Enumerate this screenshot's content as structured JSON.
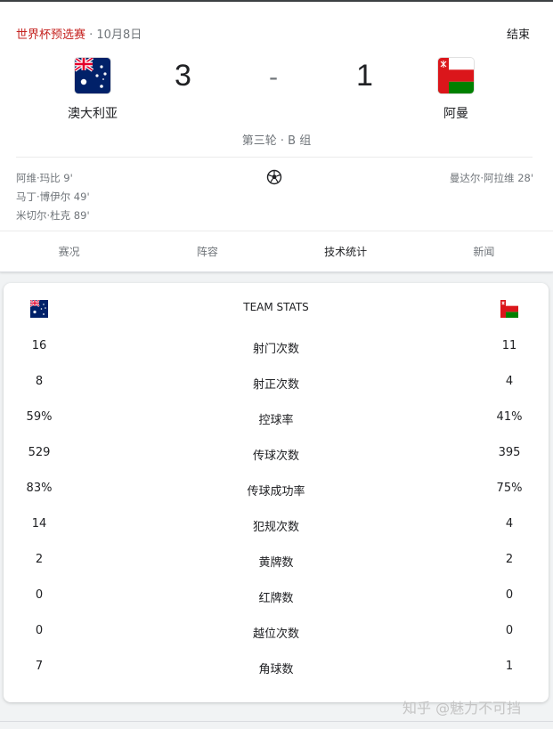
{
  "header": {
    "competition": "世界杯预选赛",
    "date": " · 10月8日",
    "status": "结束"
  },
  "match": {
    "home": {
      "name": "澳大利亚",
      "score": "3",
      "flag": "australia-flag-icon"
    },
    "away": {
      "name": "阿曼",
      "score": "1",
      "flag": "oman-flag-icon"
    },
    "separator": "-",
    "round": "第三轮 · B 组"
  },
  "scorers": {
    "home": [
      "阿维·玛比 9'",
      "马丁·博伊尔 49'",
      "米切尔·杜克 89'"
    ],
    "away": [
      "曼达尔·阿拉维 28'"
    ]
  },
  "tabs": [
    {
      "label": "赛况",
      "active": false
    },
    {
      "label": "阵容",
      "active": false
    },
    {
      "label": "技术统计",
      "active": true
    },
    {
      "label": "新闻",
      "active": false
    }
  ],
  "stats": {
    "title": "TEAM STATS",
    "rows": [
      {
        "label": "射门次数",
        "home": "16",
        "away": "11"
      },
      {
        "label": "射正次数",
        "home": "8",
        "away": "4"
      },
      {
        "label": "控球率",
        "home": "59%",
        "away": "41%"
      },
      {
        "label": "传球次数",
        "home": "529",
        "away": "395"
      },
      {
        "label": "传球成功率",
        "home": "83%",
        "away": "75%"
      },
      {
        "label": "犯规次数",
        "home": "14",
        "away": "4"
      },
      {
        "label": "黄牌数",
        "home": "2",
        "away": "2"
      },
      {
        "label": "红牌数",
        "home": "0",
        "away": "0"
      },
      {
        "label": "越位次数",
        "home": "0",
        "away": "0"
      },
      {
        "label": "角球数",
        "home": "7",
        "away": "1"
      }
    ]
  },
  "watermark": "知乎 @魅力不可挡",
  "colors": {
    "competition": "#c5221f",
    "muted": "#70757a",
    "text": "#202124"
  }
}
